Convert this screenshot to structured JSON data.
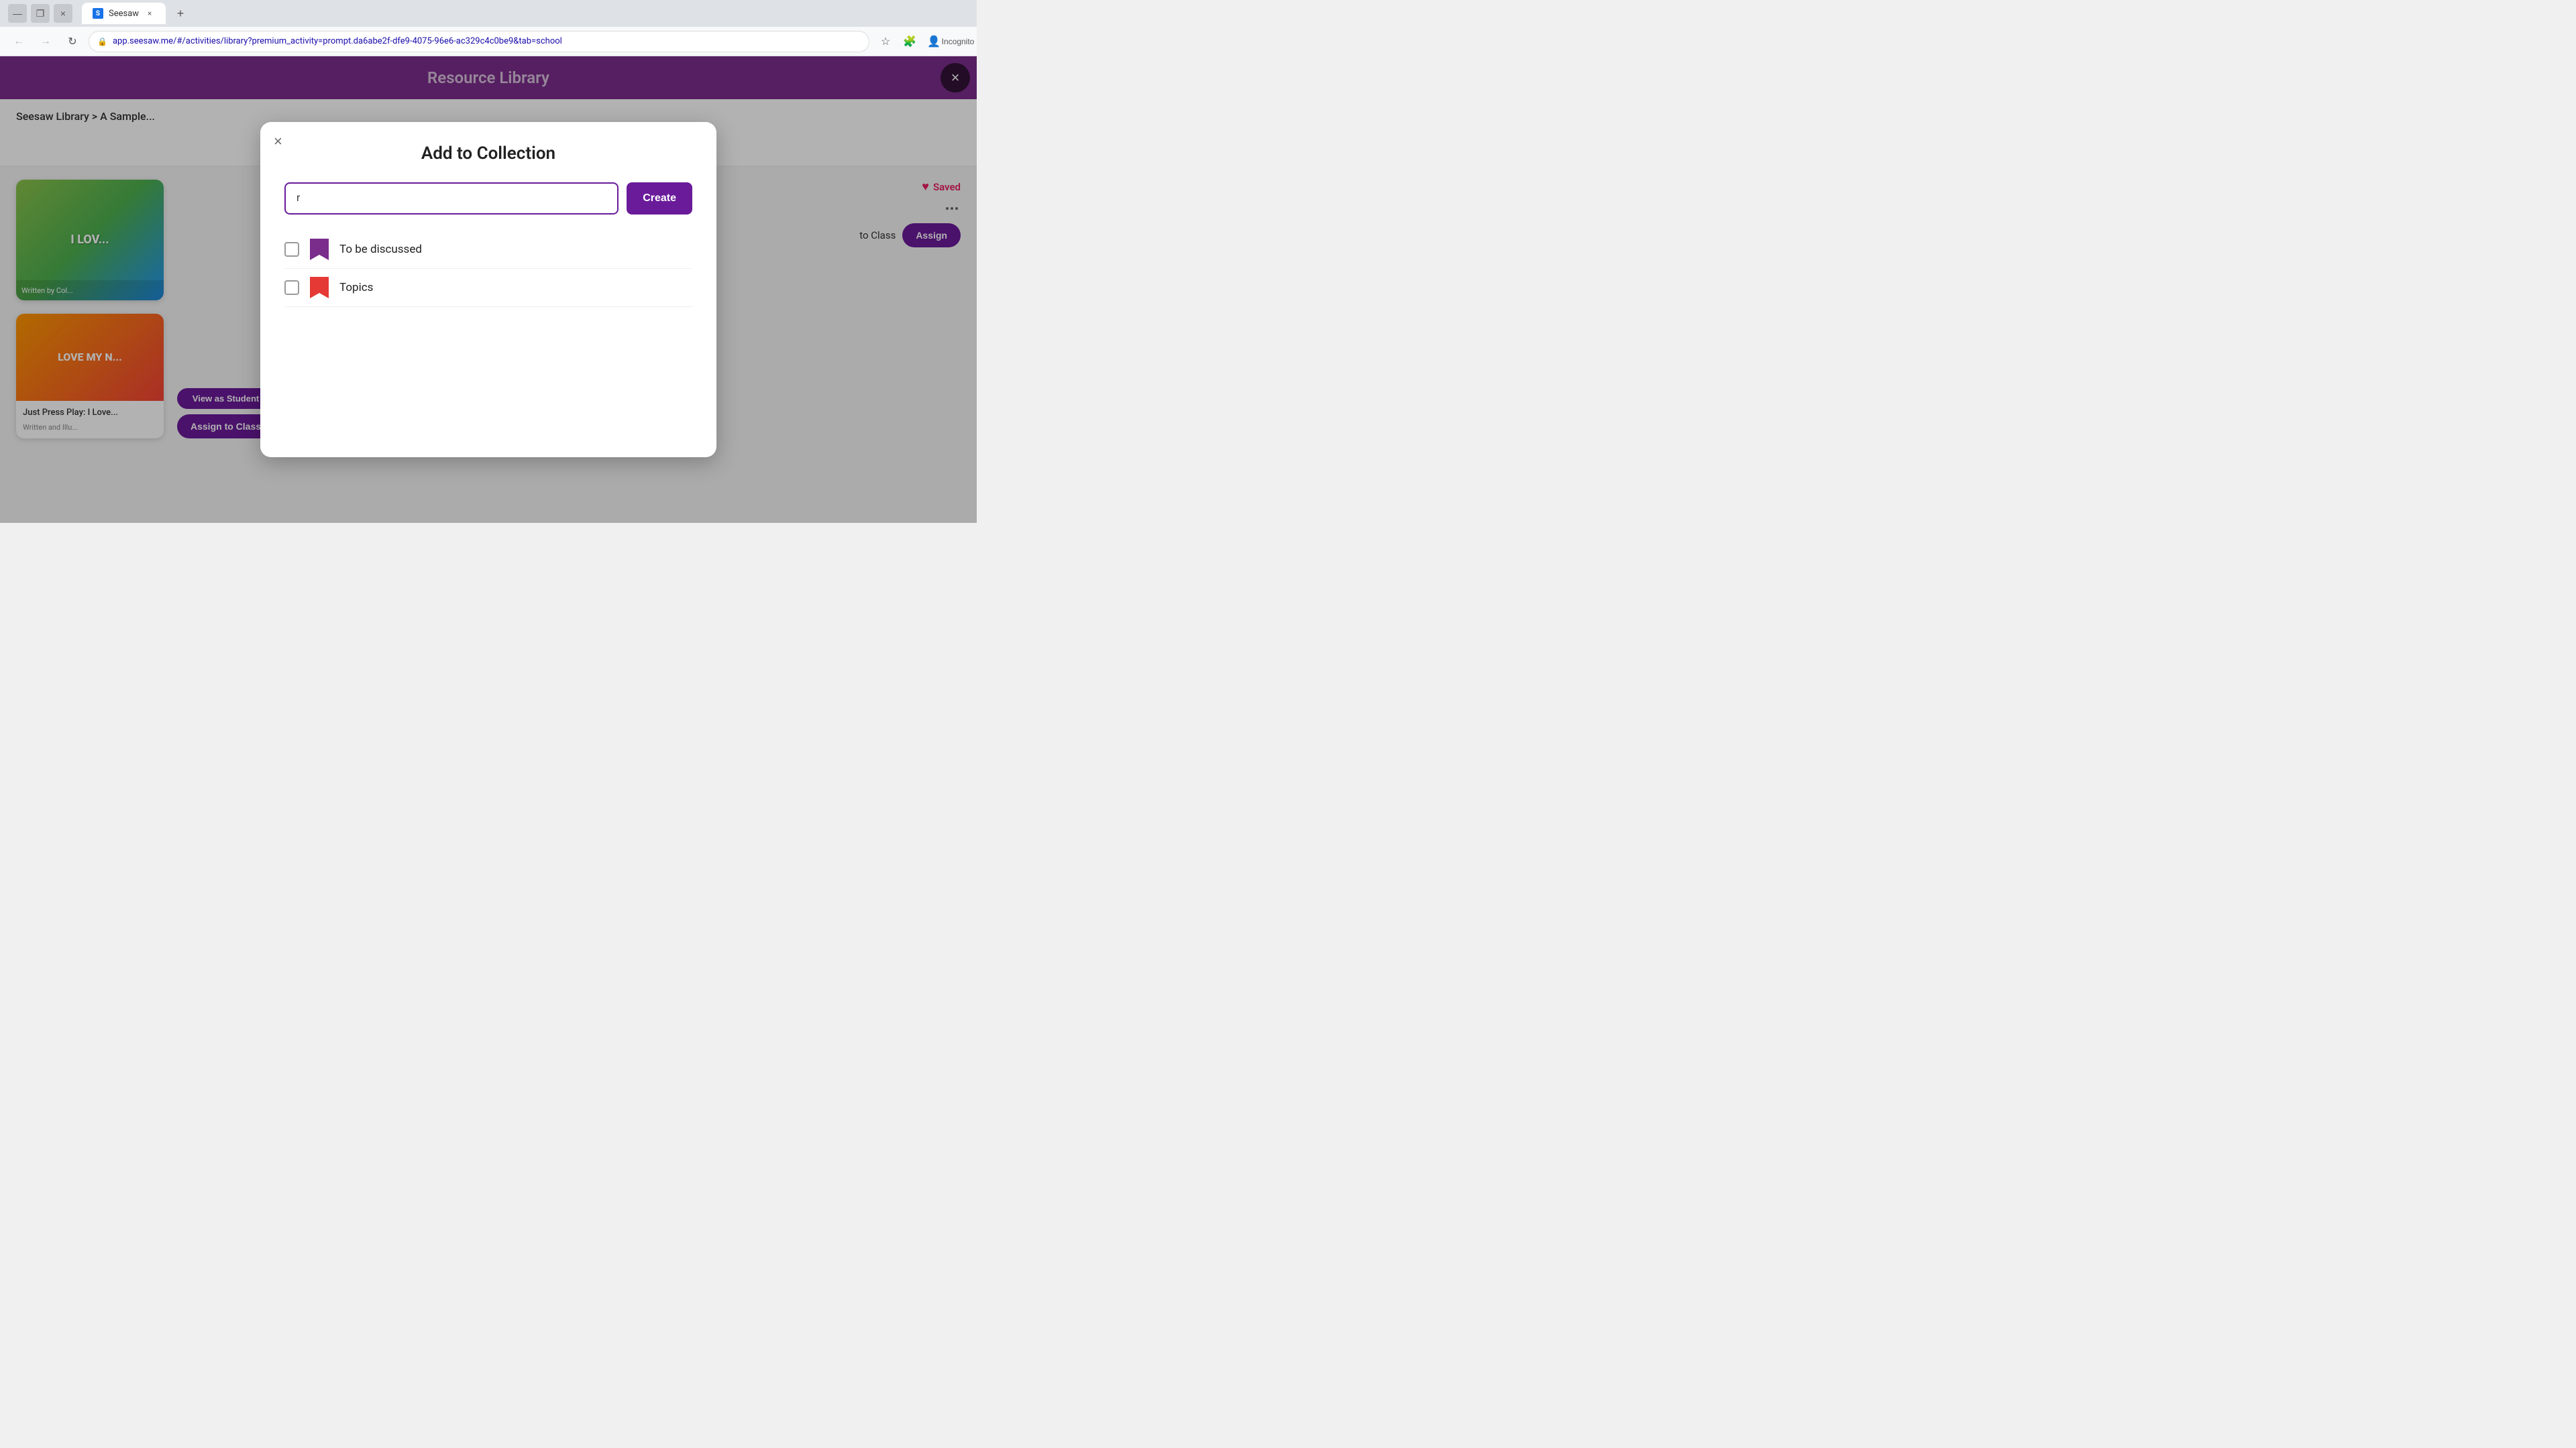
{
  "browser": {
    "tab_favicon": "S",
    "tab_label": "Seesaw",
    "tab_close": "×",
    "new_tab": "+",
    "nav_back": "←",
    "nav_forward": "→",
    "nav_refresh": "↻",
    "address_url": "app.seesaw.me/#/activities/library?premium_activity=prompt.da6abe2f-dfe9-4075-96e6-ac329c4c0be9&tab=school",
    "incognito_label": "Incognito",
    "minimize": "—",
    "maximize": "❐",
    "close_window": "×"
  },
  "page": {
    "header_title": "Resource Library",
    "close_btn": "×",
    "breadcrumb": "Seesaw Library > A Sample..."
  },
  "cards": [
    {
      "image_text": "I LOV...",
      "saved_label": "Saved",
      "dots": "...",
      "to_class_label": "to Class",
      "assign_label": "Assign"
    },
    {
      "title": "Just Press Play: I Love...",
      "image_bg": "orange-red",
      "view_student_label": "View as Student",
      "assign_to_class_label": "Assign to Class"
    }
  ],
  "modal": {
    "title": "Add to Collection",
    "close_icon": "×",
    "input_placeholder": "r",
    "create_btn_label": "Create",
    "collections": [
      {
        "name": "To be discussed",
        "bookmark_color": "purple",
        "checked": false
      },
      {
        "name": "Topics",
        "bookmark_color": "red",
        "checked": false
      }
    ]
  },
  "colors": {
    "purple": "#6a1b9a",
    "header_purple": "#7b2d8b",
    "red": "#e53935",
    "pink": "#e91e63"
  }
}
